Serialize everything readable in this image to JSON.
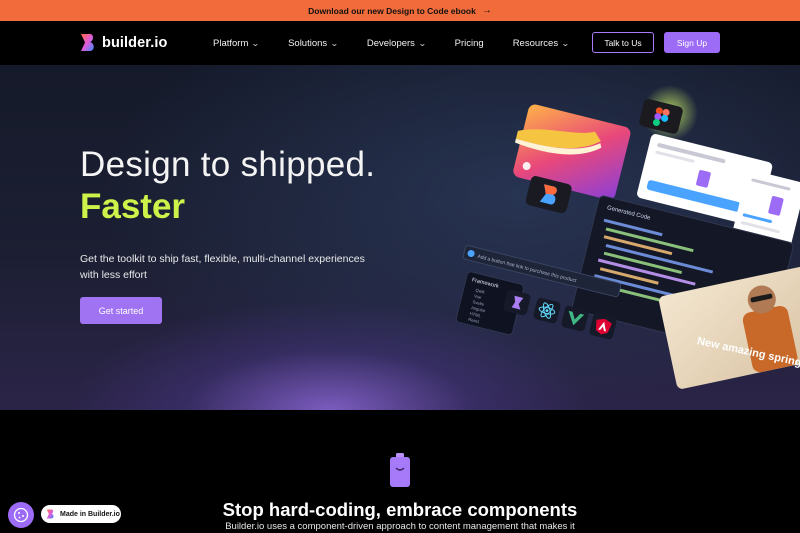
{
  "banner": {
    "text": "Download our new Design to Code ebook",
    "arrow": "→"
  },
  "nav": {
    "logo_text": "builder.io",
    "links": [
      {
        "label": "Platform",
        "has_dropdown": true
      },
      {
        "label": "Solutions",
        "has_dropdown": true
      },
      {
        "label": "Developers",
        "has_dropdown": true
      },
      {
        "label": "Pricing",
        "has_dropdown": false
      },
      {
        "label": "Resources",
        "has_dropdown": true
      }
    ],
    "talk_label": "Talk to Us",
    "signup_label": "Sign Up"
  },
  "hero": {
    "title": "Design to shipped.",
    "title_accent": "Faster",
    "subtitle": "Get the toolkit to ship fast, flexible, multi-channel experiences with less effort",
    "cta_label": "Get started",
    "art": {
      "code_panel_title": "Generated Code",
      "framework_title": "Framework",
      "framework_options": [
        "Qwik",
        "Vue",
        "Svelte",
        "Angular",
        "HTML",
        "React"
      ],
      "prompt_text": "Add a button that link to purchase this product",
      "promo_text": "New amazing spring collection"
    }
  },
  "section": {
    "title": "Stop hard-coding, embrace components",
    "text": "Builder.io uses a component-driven approach to content management that makes it"
  },
  "badge": {
    "label": "Made in Builder.io"
  },
  "colors": {
    "banner": "#f26b3a",
    "accent": "#9d6cf7",
    "lime": "#cdf34a"
  }
}
